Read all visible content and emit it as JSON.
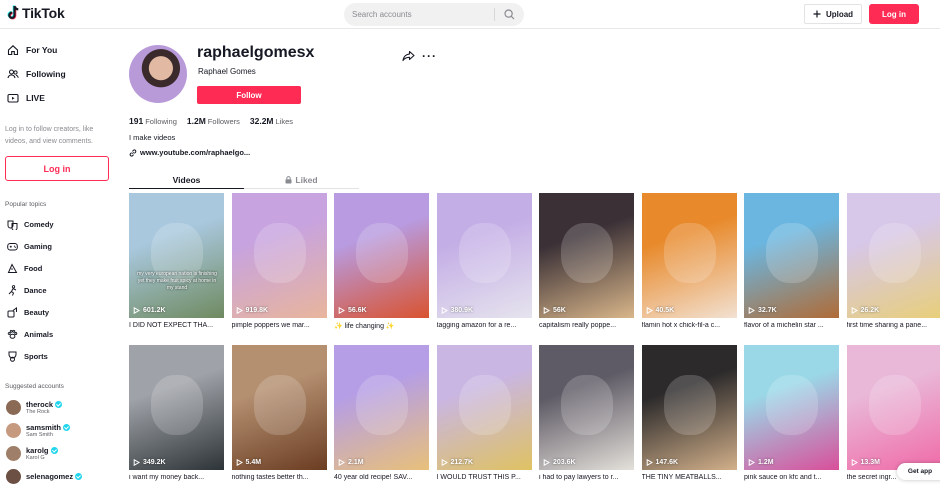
{
  "header": {
    "logo_text": "TikTok",
    "search_placeholder": "Search accounts",
    "upload_label": "Upload",
    "login_label": "Log in"
  },
  "sidebar": {
    "nav": [
      {
        "label": "For You",
        "icon": "home-icon"
      },
      {
        "label": "Following",
        "icon": "users-icon"
      },
      {
        "label": "LIVE",
        "icon": "live-icon"
      }
    ],
    "hint": "Log in to follow creators, like videos, and view comments.",
    "login_label": "Log in",
    "topics_heading": "Popular topics",
    "topics": [
      {
        "label": "Comedy",
        "icon": "comedy-icon"
      },
      {
        "label": "Gaming",
        "icon": "gaming-icon"
      },
      {
        "label": "Food",
        "icon": "food-icon"
      },
      {
        "label": "Dance",
        "icon": "dance-icon"
      },
      {
        "label": "Beauty",
        "icon": "beauty-icon"
      },
      {
        "label": "Animals",
        "icon": "animals-icon"
      },
      {
        "label": "Sports",
        "icon": "sports-icon"
      }
    ],
    "accounts_heading": "Suggested accounts",
    "accounts": [
      {
        "handle": "therock",
        "name": "The Rock",
        "color": "#8a6a55"
      },
      {
        "handle": "samsmith",
        "name": "Sam Smith",
        "color": "#c69a7f"
      },
      {
        "handle": "karolg",
        "name": "Karol G",
        "color": "#9f7f6a"
      },
      {
        "handle": "selenagomez",
        "name": "",
        "color": "#6b5043"
      }
    ]
  },
  "profile": {
    "username": "raphaelgomesx",
    "display_name": "Raphael Gomes",
    "follow_label": "Follow",
    "following_count": "191",
    "following_label": "Following",
    "followers_count": "1.2M",
    "followers_label": "Followers",
    "likes_count": "32.2M",
    "likes_label": "Likes",
    "bio": "I make videos",
    "link": "www.youtube.com/raphaelgo..."
  },
  "tabs": {
    "videos": "Videos",
    "liked": "Liked"
  },
  "videos": [
    {
      "views": "601.2K",
      "caption": "I DID NOT EXPECT THA...",
      "colors": [
        "#a9c8de",
        "#6f8a60"
      ],
      "overlay": "my very european nation is finishing yet they make fruit spicy at home in my stand"
    },
    {
      "views": "919.8K",
      "caption": "pimple poppers we mar...",
      "colors": [
        "#c7a3e0",
        "#e8b59c"
      ],
      "overlay": ""
    },
    {
      "views": "56.6K",
      "caption": "✨ life changing ✨",
      "colors": [
        "#b89be0",
        "#d9532f"
      ],
      "overlay": ""
    },
    {
      "views": "380.9K",
      "caption": "tagging amazon for a re...",
      "colors": [
        "#c4aee6",
        "#e6e4ee"
      ],
      "overlay": ""
    },
    {
      "views": "56K",
      "caption": "capitalism really poppe...",
      "colors": [
        "#3a3036",
        "#d9b68a"
      ],
      "overlay": ""
    },
    {
      "views": "40.5K",
      "caption": "flamin hot x chick-fil-a c...",
      "colors": [
        "#e88a2c",
        "#f2e1d2"
      ],
      "overlay": ""
    },
    {
      "views": "32.7K",
      "caption": "flavor of a michelin star ...",
      "colors": [
        "#6bb6e0",
        "#b06b36"
      ],
      "overlay": ""
    },
    {
      "views": "26.2K",
      "caption": "first time sharing a pane...",
      "colors": [
        "#d7c7e8",
        "#e8cf7a"
      ],
      "overlay": ""
    },
    {
      "views": "349.2K",
      "caption": "i want my money back...",
      "colors": [
        "#9fa2a8",
        "#2d3437"
      ],
      "overlay": ""
    },
    {
      "views": "5.4M",
      "caption": "nothing tastes better th...",
      "colors": [
        "#b48f70",
        "#6b3d22"
      ],
      "overlay": ""
    },
    {
      "views": "2.1M",
      "caption": "40 year old recipe! SAV...",
      "colors": [
        "#b59ee6",
        "#e8c07a"
      ],
      "overlay": ""
    },
    {
      "views": "212.7K",
      "caption": "I WOULD TRUST THIS P...",
      "colors": [
        "#c9b6e2",
        "#dfc262"
      ],
      "overlay": ""
    },
    {
      "views": "203.6K",
      "caption": "i had to pay lawyers to r...",
      "colors": [
        "#5f5b66",
        "#e4e0da"
      ],
      "overlay": ""
    },
    {
      "views": "147.6K",
      "caption": "THE TINY MEATBALLS...",
      "colors": [
        "#2c2a2b",
        "#d2b08a"
      ],
      "overlay": ""
    },
    {
      "views": "1.2M",
      "caption": "pink sauce on kfc and t...",
      "colors": [
        "#9ad8e8",
        "#d94f9a"
      ],
      "overlay": ""
    },
    {
      "views": "13.3M",
      "caption": "the secret ingr...",
      "colors": [
        "#e9b8d8",
        "#f06aa8"
      ],
      "overlay": ""
    }
  ],
  "get_app": "Get app"
}
